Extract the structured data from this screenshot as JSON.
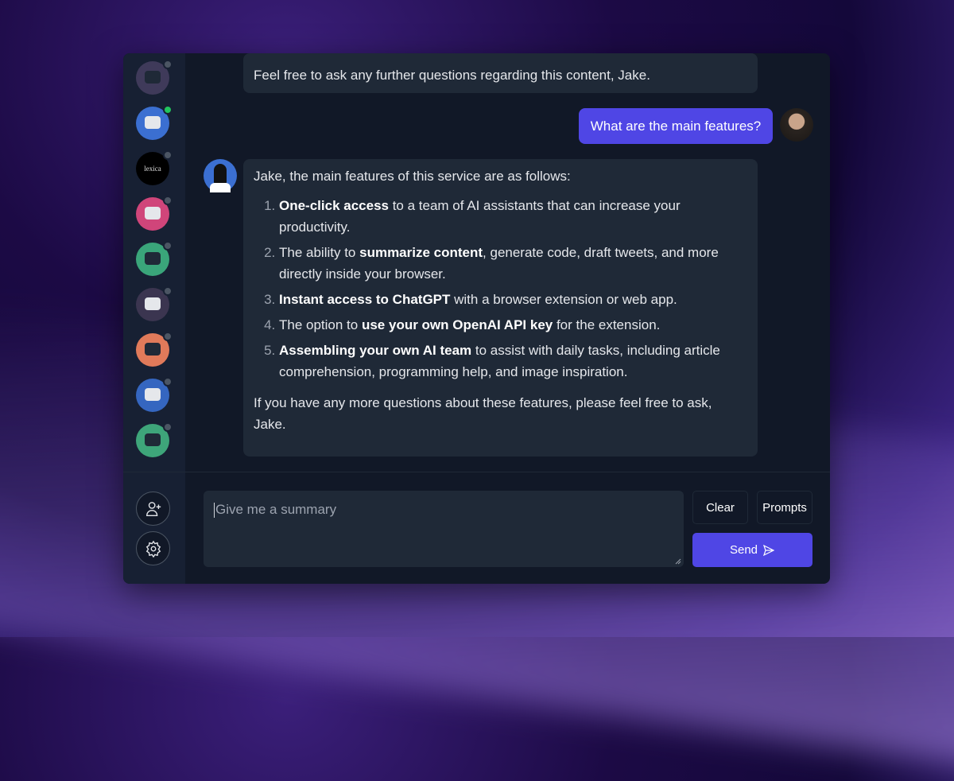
{
  "sidebar": {
    "assistants": [
      {
        "name": "robot-blue-face",
        "online": false,
        "color": "#3f3a5a"
      },
      {
        "name": "robot-chatgpt",
        "online": true,
        "color": "#3b6fd1"
      },
      {
        "name": "lexica",
        "label": "Lexica",
        "online": false,
        "color": "#000000"
      },
      {
        "name": "robot-pink-goggles",
        "online": false,
        "color": "#d0457a"
      },
      {
        "name": "robot-green-visor",
        "online": false,
        "color": "#3aa57a"
      },
      {
        "name": "robot-red-helmet",
        "online": false,
        "color": "#3b3550"
      },
      {
        "name": "robot-orange-diver",
        "online": false,
        "color": "#e07a5a"
      },
      {
        "name": "robot-blue-goggles",
        "online": false,
        "color": "#3566c0"
      },
      {
        "name": "robot-pink-antenna",
        "online": false,
        "color": "#3ea57a"
      }
    ]
  },
  "chat": {
    "prev_message": "Feel free to ask any further questions regarding this content, Jake.",
    "user_message": "What are the main features?",
    "reply": {
      "intro": "Jake, the main features of this service are as follows:",
      "items": [
        {
          "bold": "One-click access",
          "rest": " to a team of AI assistants that can increase your productivity."
        },
        {
          "pre": "The ability to ",
          "bold": "summarize content",
          "rest": ", generate code, draft tweets, and more directly inside your browser."
        },
        {
          "bold": "Instant access to ChatGPT",
          "rest": " with a browser extension or web app."
        },
        {
          "pre": "The option to ",
          "bold": "use your own OpenAI API key",
          "rest": " for the extension."
        },
        {
          "bold": "Assembling your own AI team",
          "rest": " to assist with daily tasks, including article comprehension, programming help, and image inspiration."
        }
      ],
      "outro": "If you have any more questions about these features, please feel free to ask, Jake."
    }
  },
  "composer": {
    "placeholder": "Give me a summary",
    "clear": "Clear",
    "prompts": "Prompts",
    "send": "Send"
  },
  "colors": {
    "accent": "#4f46e5",
    "panel": "#111827",
    "bubble": "#1f2937",
    "online": "#22c55e"
  }
}
